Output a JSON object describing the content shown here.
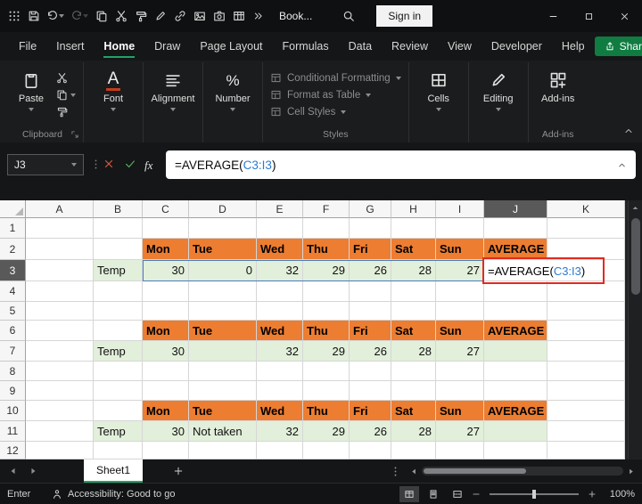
{
  "titlebar": {
    "title": "Book...",
    "sign_in": "Sign in",
    "qat_icons": [
      "app-launcher",
      "save",
      "undo",
      "redo",
      "copy",
      "cut",
      "format-painter",
      "draw",
      "link",
      "image",
      "camera",
      "table"
    ]
  },
  "menubar": {
    "items": [
      "File",
      "Insert",
      "Home",
      "Draw",
      "Page Layout",
      "Formulas",
      "Data",
      "Review",
      "View",
      "Developer",
      "Help"
    ],
    "active_item": "Home",
    "share": "Share"
  },
  "ribbon": {
    "paste": "Paste",
    "clipboard_group": "Clipboard",
    "font": "Font",
    "alignment": "Alignment",
    "number": "Number",
    "styles_items": [
      "Conditional Formatting",
      "Format as Table",
      "Cell Styles"
    ],
    "styles_group": "Styles",
    "cells": "Cells",
    "editing": "Editing",
    "addins": "Add-ins",
    "addins_group": "Add-ins"
  },
  "formula_bar": {
    "name_box": "J3",
    "fx": "fx",
    "formula": {
      "prefix": "=AVERAGE(",
      "ref": "C3:I3",
      "suffix": ")"
    }
  },
  "grid": {
    "column_headers": [
      "A",
      "B",
      "C",
      "D",
      "E",
      "F",
      "G",
      "H",
      "I",
      "J",
      "K"
    ],
    "row_headers": [
      "1",
      "2",
      "3",
      "4",
      "5",
      "6",
      "7",
      "8",
      "9",
      "10",
      "11",
      "12"
    ],
    "selected_column": "J",
    "selected_row": "3",
    "day_headers": [
      "Mon",
      "Tue",
      "Wed",
      "Thu",
      "Fri",
      "Sat",
      "Sun"
    ],
    "average_header": "AVERAGE",
    "row_label": "Temp",
    "blocks": [
      {
        "header_row": 2,
        "data_row": 3,
        "values": [
          "30",
          "0",
          "32",
          "29",
          "26",
          "28",
          "27"
        ],
        "average": "formula"
      },
      {
        "header_row": 6,
        "data_row": 7,
        "values": [
          "30",
          "",
          "32",
          "29",
          "26",
          "28",
          "27"
        ],
        "average": ""
      },
      {
        "header_row": 10,
        "data_row": 11,
        "values": [
          "30",
          "Not taken",
          "32",
          "29",
          "26",
          "28",
          "27"
        ],
        "average": ""
      }
    ]
  },
  "sheet_bar": {
    "active_tab": "Sheet1"
  },
  "status_bar": {
    "mode": "Enter",
    "accessibility": "Accessibility: Good to go",
    "zoom_level": "100%"
  },
  "colors": {
    "header_fill": "#ED7D31",
    "data_fill": "#E2EFDA",
    "accent_green": "#21A366",
    "share_green": "#107C41",
    "ref_blue": "#2B7BD3",
    "annotation_red": "#E02B20"
  }
}
